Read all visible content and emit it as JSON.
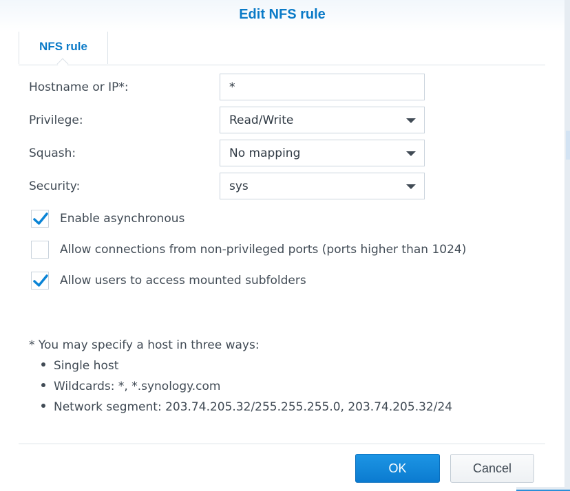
{
  "dialog": {
    "title": "Edit NFS rule",
    "tab_label": "NFS rule"
  },
  "form": {
    "hostname_label": "Hostname or IP*:",
    "hostname_value": "*",
    "privilege_label": "Privilege:",
    "privilege_value": "Read/Write",
    "squash_label": "Squash:",
    "squash_value": "No mapping",
    "security_label": "Security:",
    "security_value": "sys"
  },
  "options": [
    {
      "label": "Enable asynchronous",
      "checked": true
    },
    {
      "label": "Allow connections from non-privileged ports (ports higher than 1024)",
      "checked": false
    },
    {
      "label": "Allow users to access mounted subfolders",
      "checked": true
    }
  ],
  "note": {
    "intro": "* You may specify a host in three ways:",
    "items": [
      "Single host",
      "Wildcards: *, *.synology.com",
      "Network segment: 203.74.205.32/255.255.255.0, 203.74.205.32/24"
    ]
  },
  "buttons": {
    "ok": "OK",
    "cancel": "Cancel"
  },
  "colors": {
    "accent": "#0a7ac7",
    "primary_button": "#1088dc",
    "check": "#0a84d6"
  },
  "icons": {
    "dropdown": "triangle-down",
    "checkbox_checked": "checkmark"
  }
}
